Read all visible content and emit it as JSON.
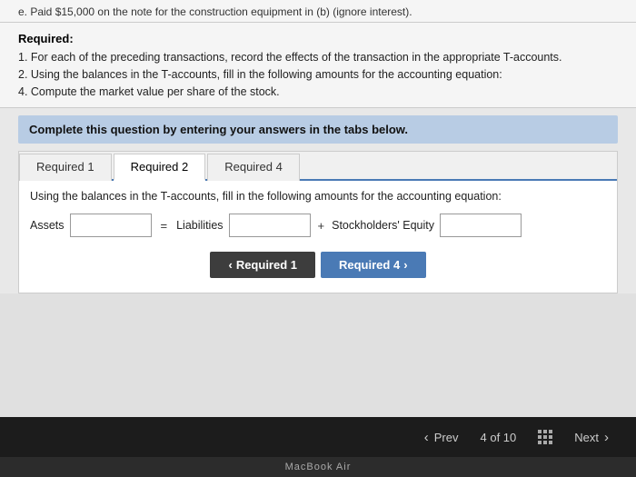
{
  "topStrip": {
    "text": "e.  Paid $15,000 on the note for the construction equipment in (b) (ignore interest)."
  },
  "requiredSection": {
    "title": "Required:",
    "items": [
      "1. For each of the preceding transactions, record the effects of the transaction in the appropriate T-accounts.",
      "2. Using the balances in the T-accounts, fill in the following amounts for the accounting equation:",
      "4. Compute the market value per share of the stock."
    ]
  },
  "instructionBox": {
    "text": "Complete this question by entering your answers in the tabs below."
  },
  "tabs": [
    {
      "id": "req1",
      "label": "Required 1",
      "active": false
    },
    {
      "id": "req2",
      "label": "Required 2",
      "active": true
    },
    {
      "id": "req4",
      "label": "Required 4",
      "active": false
    }
  ],
  "tabContent": {
    "instruction": "Using the balances in the T-accounts, fill in the following amounts for the accounting equation:",
    "equation": {
      "assetsLabel": "Assets",
      "equalsLabel": "=",
      "liabilitiesLabel": "Liabilities",
      "plusLabel": "+",
      "equityLabel": "Stockholders' Equity"
    },
    "navButtons": {
      "prev": "Required 1",
      "next": "Required 4"
    }
  },
  "bottomNav": {
    "prevLabel": "Prev",
    "pageInfo": "4 of 10",
    "nextLabel": "Next"
  },
  "macbook": {
    "label": "MacBook Air"
  }
}
